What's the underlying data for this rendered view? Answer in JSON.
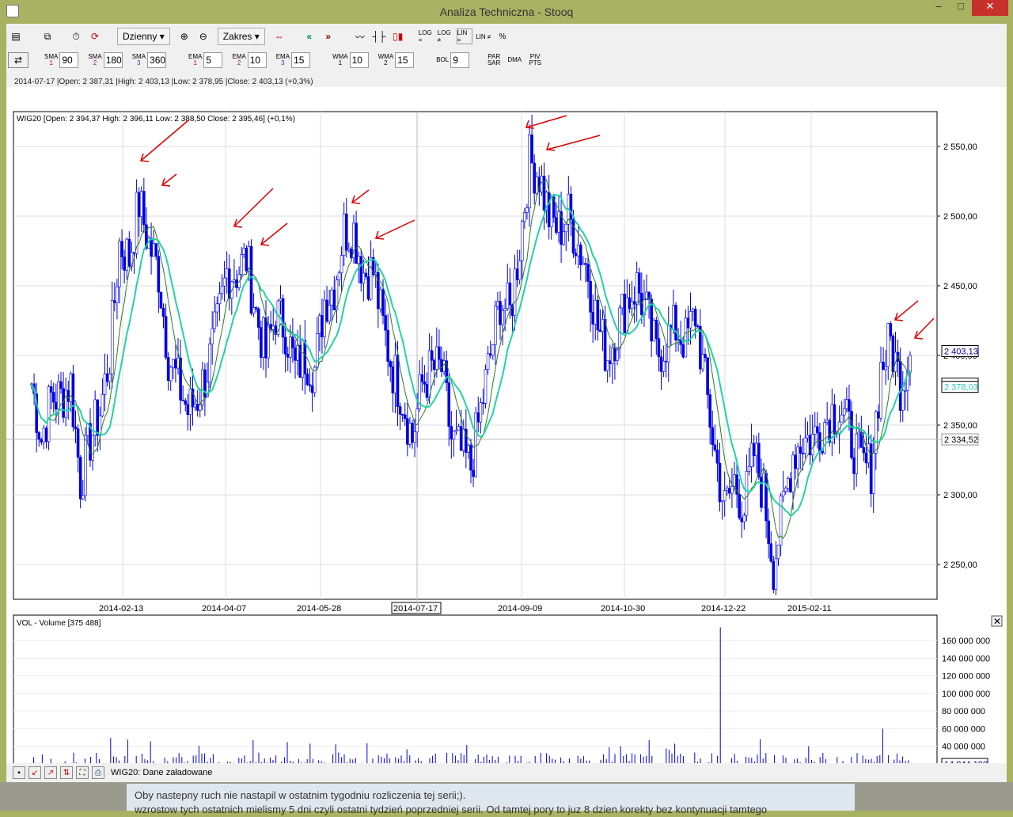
{
  "window": {
    "title": "Analiza Techniczna - Stooq",
    "minimize": "–",
    "maximize": "□",
    "close": "✕"
  },
  "toolbar1": {
    "interval": "Dzienny",
    "range": "Zakres",
    "log_eq": "LOG =",
    "log_neq": "LOG ≠",
    "lin_eq": "LIN =",
    "lin_neq": "LIN ≠",
    "percent": "%"
  },
  "toolbar2": {
    "indicators": [
      {
        "name": "SMA",
        "idx": "1",
        "value": "90"
      },
      {
        "name": "SMA",
        "idx": "2",
        "value": "180"
      },
      {
        "name": "SMA",
        "idx": "3",
        "value": "360"
      },
      {
        "name": "EMA",
        "idx": "1",
        "value": "5"
      },
      {
        "name": "EMA",
        "idx": "2",
        "value": "10"
      },
      {
        "name": "EMA",
        "idx": "3",
        "value": "15"
      },
      {
        "name": "WMA",
        "idx": "1",
        "value": "10"
      },
      {
        "name": "WMA",
        "idx": "2",
        "value": "15"
      },
      {
        "name": "BOL",
        "idx": "",
        "value": "9"
      }
    ],
    "parsar": "PAR SAR",
    "dma": "DMA",
    "pivpts": "PIV PTS"
  },
  "info_line": "2014-07-17 |Open: 2 387,31 |High: 2 403,13 |Low: 2 378,95 |Close: 2 403,13 (+0,3%)",
  "price_legend": "WIG20 [Open: 2 394,37  High: 2 396,11  Low: 2 388,50  Close: 2 395,46] (+0,1%)",
  "volume_legend": "VOL - Volume [375 488]",
  "price_markers": {
    "last": "2 403,13",
    "ma1": "2 379,80",
    "ma2": "2 378,03",
    "cursor": "2 334,52"
  },
  "volume_marker": "14 844 190",
  "status": "WIG20: Dane załadowane",
  "background_text": [
    "Oby nastepny ruch nie nastapil w ostatnim tygodniu rozliczenia tej serii;).",
    "wzrostow tych ostatnich mielismy 5 dni czyli ostatni tydzień poprzedniej serii. Od tamtej pory to juz 8 dzien korekty bez kontynuacji tamtego"
  ],
  "colors": {
    "bars": "#0000e0",
    "ma_fast": "#2e7d1e",
    "ma_slow": "#22d4a0",
    "arrows": "#e00000"
  },
  "chart_data": [
    {
      "type": "ohlc",
      "title": "WIG20",
      "ylim": [
        2225,
        2575
      ],
      "yticks": [
        "2 250,00",
        "2 300,00",
        "2 350,00",
        "2 400,00",
        "2 450,00",
        "2 500,00",
        "2 550,00"
      ],
      "ytick_values": [
        2250,
        2300,
        2350,
        2400,
        2450,
        2500,
        2550
      ],
      "xticks": [
        "2014-02-13",
        "2014-04-07",
        "2014-05-28",
        "2014-07-17",
        "2014-09-09",
        "2014-10-30",
        "2014-12-22",
        "2015-02-11"
      ],
      "close": [
        2380,
        2340,
        2370,
        2370,
        2380,
        2310,
        2340,
        2360,
        2400,
        2480,
        2470,
        2510,
        2480,
        2460,
        2400,
        2380,
        2360,
        2370,
        2390,
        2420,
        2460,
        2460,
        2470,
        2430,
        2400,
        2430,
        2420,
        2390,
        2400,
        2390,
        2440,
        2450,
        2490,
        2490,
        2460,
        2460,
        2420,
        2390,
        2370,
        2340,
        2380,
        2390,
        2390,
        2340,
        2330,
        2320,
        2360,
        2400,
        2440,
        2430,
        2480,
        2540,
        2530,
        2500,
        2490,
        2500,
        2480,
        2460,
        2420,
        2400,
        2420,
        2440,
        2450,
        2430,
        2400,
        2410,
        2420,
        2410,
        2430,
        2380,
        2330,
        2290,
        2310,
        2290,
        2330,
        2300,
        2250,
        2290,
        2330,
        2340,
        2340,
        2350,
        2360,
        2360,
        2340,
        2320,
        2320,
        2390,
        2410,
        2380,
        2400
      ]
    },
    {
      "type": "bar",
      "title": "Volume",
      "ylim": [
        0,
        180000000
      ],
      "yticks": [
        "40 000 000",
        "60 000 000",
        "80 000 000",
        "100 000 000",
        "120 000 000",
        "140 000 000",
        "160 000 000"
      ],
      "ytick_values": [
        40000000,
        60000000,
        80000000,
        100000000,
        120000000,
        140000000,
        160000000
      ],
      "spikes": [
        {
          "date": "2014-12-19",
          "value": 175000000
        },
        {
          "date": "2015-03-20",
          "value": 60000000
        }
      ],
      "typical_range": [
        15000000,
        45000000
      ]
    }
  ]
}
